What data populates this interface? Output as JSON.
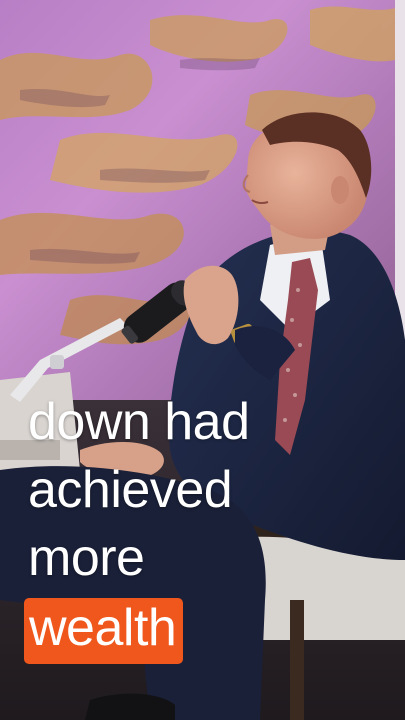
{
  "captions": {
    "line1": "down had",
    "line2": "achieved",
    "line3": "more",
    "highlight": "wealth"
  },
  "colors": {
    "highlight_background": "#f0571c",
    "caption_text": "#ffffff",
    "backdrop_purple": "#b982c6",
    "backdrop_gold": "#c99a55",
    "suit": "#1b2240"
  }
}
